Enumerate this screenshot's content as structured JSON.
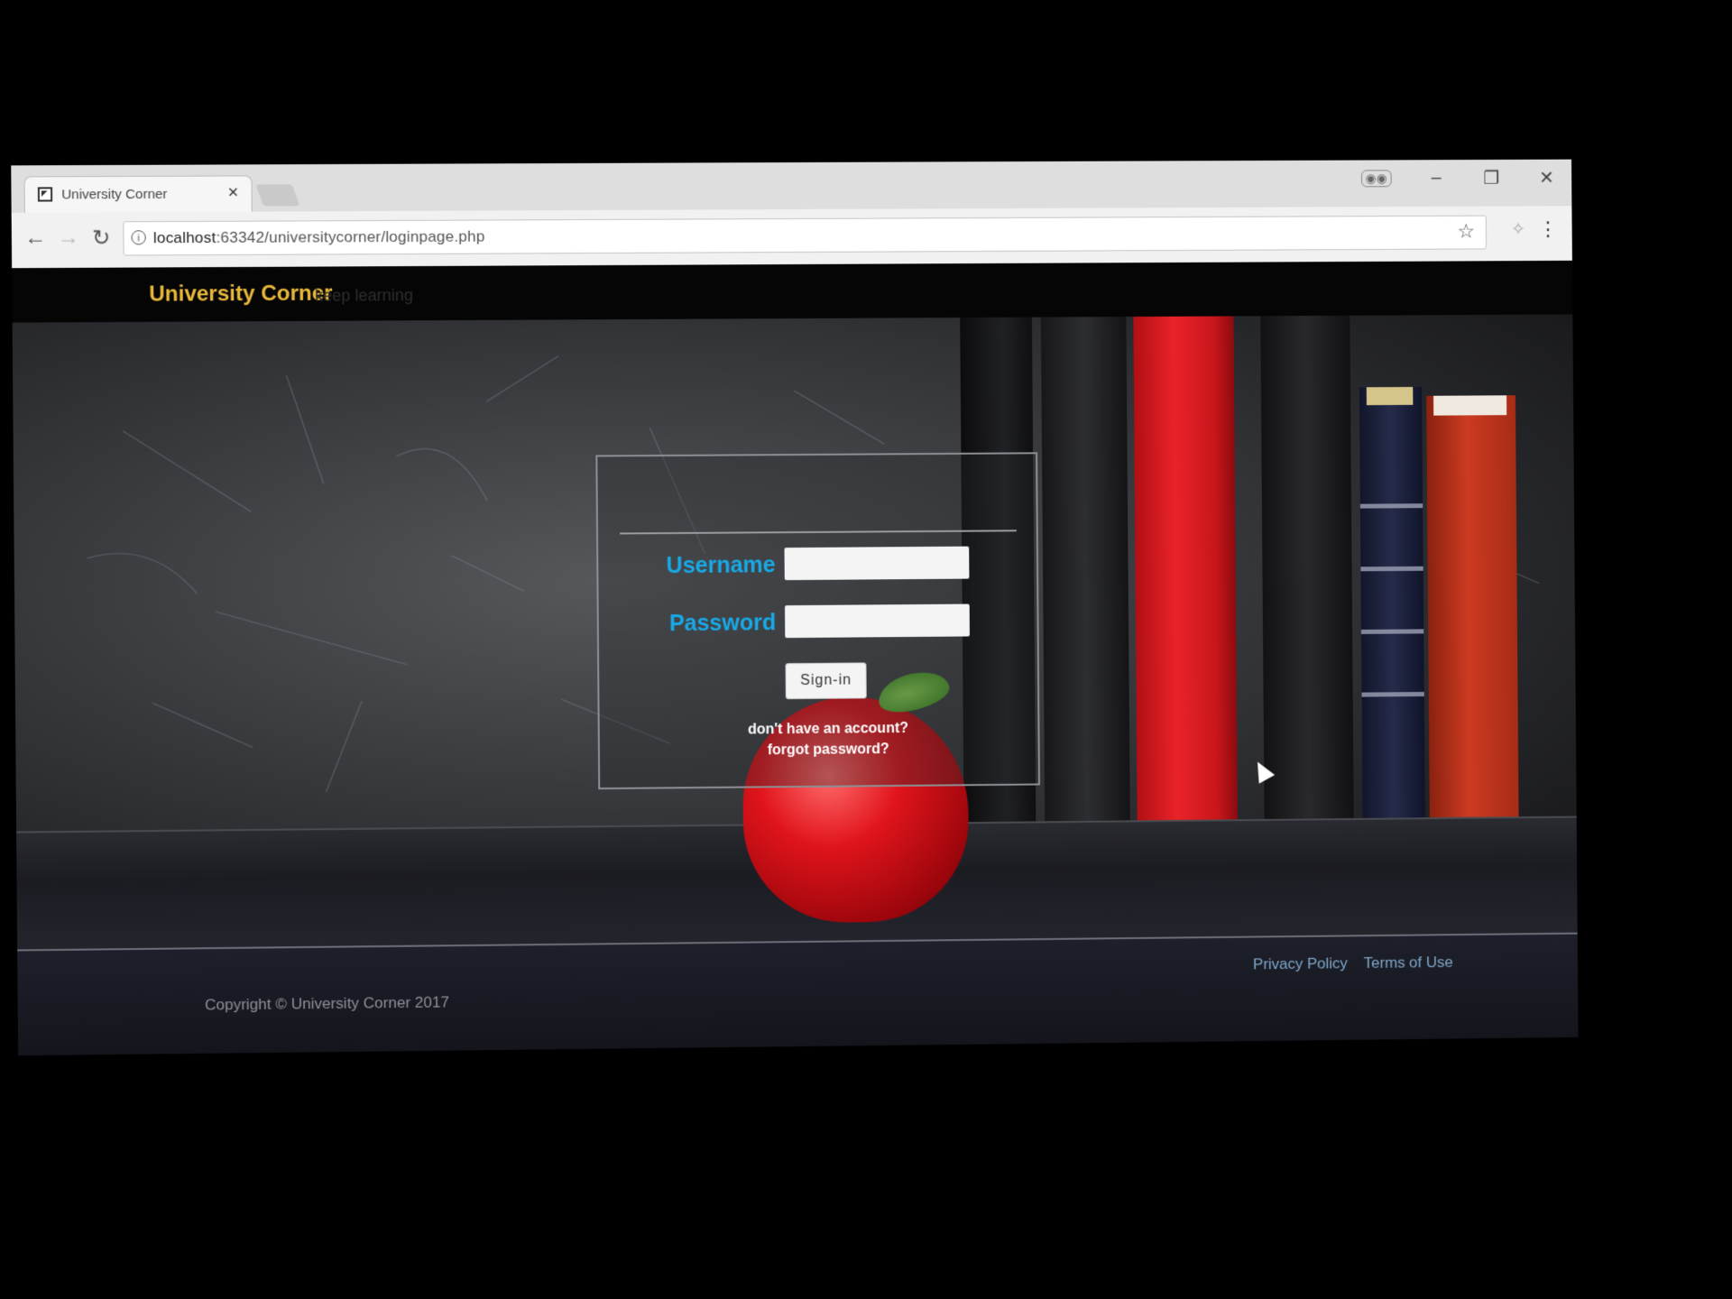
{
  "browser": {
    "tab_title": "University Corner",
    "tab_close": "×",
    "url_host": "localhost",
    "url_path": ":63342/universitycorner/loginpage.php",
    "info_glyph": "i",
    "star_glyph": "☆",
    "menu_glyph": "⋮",
    "back_glyph": "←",
    "forward_glyph": "→",
    "reload_glyph": "↻",
    "minimize_glyph": "–",
    "restore_glyph": "❐",
    "close_glyph": "✕"
  },
  "site": {
    "brand": "University Corner",
    "tagline": "keep learning"
  },
  "login": {
    "username_label": "Username",
    "password_label": "Password",
    "username_value": "",
    "password_value": "",
    "signin_label": "Sign-in",
    "signup_link": "don't have an account?",
    "forgot_link": "forgot password?"
  },
  "footer": {
    "privacy_link": "Privacy Policy",
    "terms_link": "Terms of Use",
    "copyright": "Copyright © University Corner 2017"
  },
  "colors": {
    "brand": "#e8b83a",
    "label_blue": "#18a9e6",
    "footer_link": "#7fa7c8"
  }
}
